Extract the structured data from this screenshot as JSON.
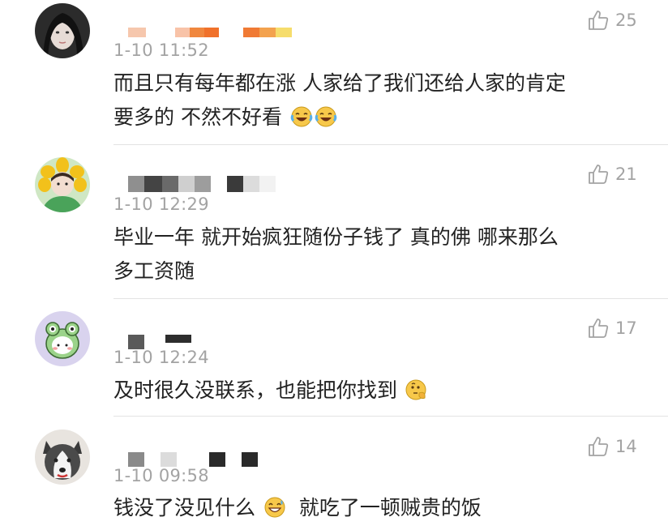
{
  "comments": [
    {
      "timestamp": "1-10 11:52",
      "likes": "25",
      "lines": [
        "而且只有每年都在涨 人家给了我们还给人家的肯定",
        "要多的 不然不好看"
      ],
      "emojis": [
        "laugh-cry-emoji",
        "laugh-cry-emoji"
      ],
      "name_blocks": [
        "#f6c7ad",
        "#ffffff",
        "#f8c3a8",
        "#f0873e",
        "#f0712b",
        "#ffffff",
        "#f07a34",
        "#f3a24e",
        "#f6dd6c"
      ]
    },
    {
      "timestamp": "1-10 12:29",
      "likes": "21",
      "lines": [
        "毕业一年 就开始疯狂随份子钱了 真的佛 哪来那么",
        "多工资随"
      ],
      "emojis": [],
      "name_blocks": [
        "#8f8f8f",
        "#444444",
        "#6a6a6a",
        "#cfcfcf",
        "#9d9d9d",
        "#ffffff",
        "#3a3a3a",
        "#dcdcdc",
        "#f2f2f2"
      ]
    },
    {
      "timestamp": "1-10 12:24",
      "likes": "17",
      "lines": [
        "及时很久没联系，也能把你找到"
      ],
      "emojis": [
        "thinking-emoji"
      ],
      "name_blocks": [
        "#5a5a5a",
        "#ffffff",
        "#2d2d2d"
      ]
    },
    {
      "timestamp": "1-10 09:58",
      "likes": "14",
      "lines": [
        "钱没了没见什么",
        "就吃了一顿贼贵的饭"
      ],
      "emojis": [
        "grin-sweat-emoji"
      ],
      "name_blocks": [
        "#8a8a8a",
        "#ffffff",
        "#dcdcdc",
        "#ffffff",
        "#2a2a2a",
        "#2a2a2a"
      ]
    }
  ],
  "colors": {
    "text": "#222222",
    "meta": "#a3a3a3",
    "divider": "#e3e3e3"
  }
}
